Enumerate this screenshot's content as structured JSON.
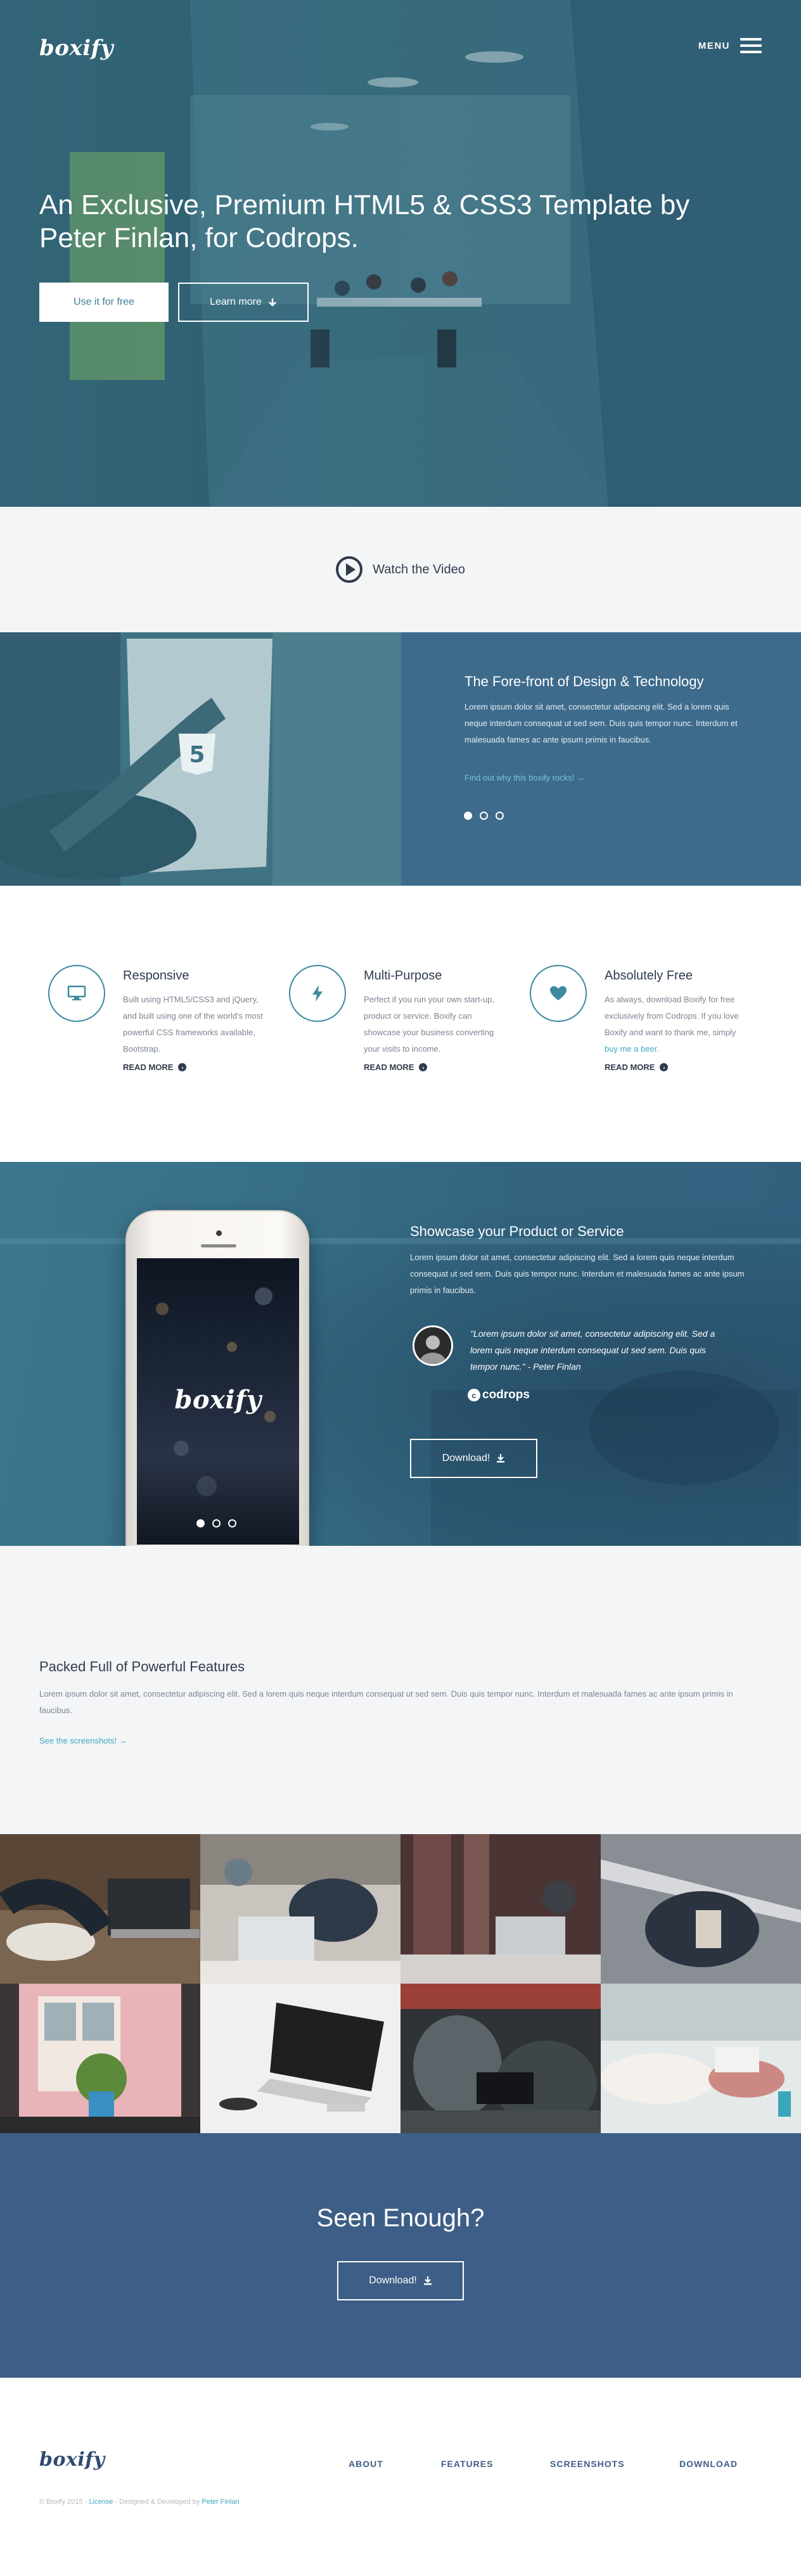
{
  "brand": {
    "logo": "boxify"
  },
  "header": {
    "menu_label": "MENU"
  },
  "hero": {
    "title": "An Exclusive, Premium HTML5 & CSS3 Template by Peter Finlan, for Codrops.",
    "primary_button": "Use it for free",
    "secondary_button": "Learn more"
  },
  "video": {
    "label": "Watch the Video"
  },
  "forefront": {
    "title": "The Fore-front of Design & Technology",
    "text": "Lorem ipsum dolor sit amet, consectetur adipiscing elit. Sed a lorem quis neque interdum consequat ut sed sem. Duis quis tempor nunc. Interdum et malesuada fames ac ante ipsum primis in faucibus.",
    "link": "Find out why this boxify rocks! →",
    "slide_dots": 3,
    "active_slide": 1
  },
  "features": [
    {
      "icon": "monitor-icon",
      "title": "Responsive",
      "text": "Built using HTML5/CSS3 and jQuery, and built using one of the world's most powerful CSS frameworks available, Bootstrap.",
      "link": "READ MORE"
    },
    {
      "icon": "bolt-icon",
      "title": "Multi-Purpose",
      "text": "Perfect if you run your own start-up, product or service. Boxify can showcase your business converting your visits to income.",
      "link": "READ MORE"
    },
    {
      "icon": "heart-icon",
      "title": "Absolutely Free",
      "text_before": "As always, download Boxify for free exclusively from Codrops. If you love Boxify and want to thank me, simply",
      "text_link": "buy me a beer.",
      "link": "READ MORE"
    }
  ],
  "showcase": {
    "title": "Showcase your Product or Service",
    "text": "Lorem ipsum dolor sit amet, consectetur adipiscing elit. Sed a lorem quis neque interdum consequat ut sed sem. Duis quis tempor nunc. Interdum et malesuada fames ac ante ipsum primis in faucibus.",
    "quote": "\"Lorem ipsum dolor sit amet, consectetur adipiscing elit. Sed a lorem quis neque interdum consequat ut sed sem. Duis quis tempor nunc.\" - Peter Finlan",
    "partner_logo": "codrops",
    "download_button": "Download!",
    "phone_logo": "boxify",
    "phone_dots": 3,
    "phone_active": 1
  },
  "packed": {
    "title": "Packed Full of Powerful Features",
    "text": "Lorem ipsum dolor sit amet, consectetur adipiscing elit. Sed a lorem quis neque interdum consequat ut sed sem. Duis quis tempor nunc. Interdum et malesuada fames ac ante ipsum primis in faucibus.",
    "link": "See the screenshots! →"
  },
  "gallery": {
    "tile_count": 8
  },
  "cta": {
    "title": "Seen Enough?",
    "button": "Download!"
  },
  "footer": {
    "logo": "boxify",
    "nav": [
      "ABOUT",
      "FEATURES",
      "SCREENSHOTS",
      "DOWNLOAD"
    ],
    "copyright_prefix": "© Boxify 2015 -",
    "license": "License",
    "copyright_middle": "- Designed & Developed by",
    "author": "Peter Finlan"
  },
  "colors": {
    "accent": "#3da8c4",
    "dark": "#2f3b4c",
    "navy": "#3d5e86",
    "teal": "#3d8aa0"
  }
}
